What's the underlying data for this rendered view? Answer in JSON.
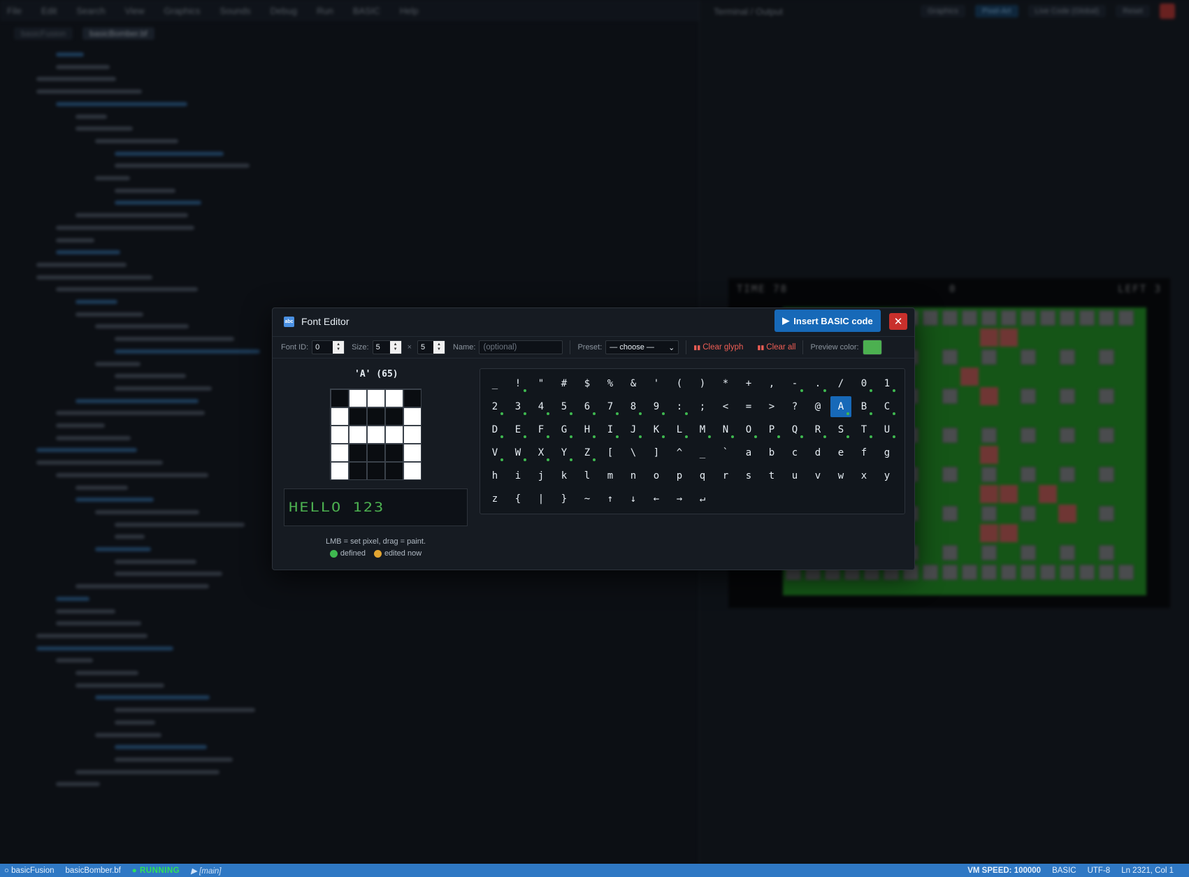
{
  "background": {
    "menu": [
      "File",
      "Edit",
      "Search",
      "View",
      "Graphics",
      "Sounds",
      "Debug",
      "Run",
      "BASIC",
      "Help"
    ],
    "tabs": [
      "basicFusion",
      "basicBomber.bf"
    ],
    "right_pane_title": "Terminal / Output",
    "right_buttons": [
      "Graphics",
      "Pixel-Art",
      "Live Code (Global)",
      "Reset"
    ],
    "hud": {
      "left": "TIME 78",
      "mid": "0",
      "right": "LEFT 3"
    }
  },
  "modal": {
    "title": "Font Editor",
    "insert_label": "Insert BASIC code",
    "close_symbol": "✕",
    "toolbar": {
      "font_id_label": "Font ID:",
      "font_id": "0",
      "size_label": "Size:",
      "size_w": "5",
      "size_x": "×",
      "size_h": "5",
      "name_label": "Name:",
      "name_placeholder": "(optional)",
      "preset_label": "Preset:",
      "preset_value": "— choose —",
      "clear_glyph": "Clear glyph",
      "clear_all": "Clear all",
      "preview_color_label": "Preview color:",
      "preview_color": "#4cb050"
    },
    "glyph": {
      "title": "'A' (65)",
      "pixels": [
        [
          0,
          1,
          1,
          1,
          0
        ],
        [
          1,
          0,
          0,
          0,
          1
        ],
        [
          1,
          1,
          1,
          1,
          1
        ],
        [
          1,
          0,
          0,
          0,
          1
        ],
        [
          1,
          0,
          0,
          0,
          1
        ]
      ]
    },
    "preview_text": "HELLO 123",
    "hint": "LMB = set pixel, drag = paint.",
    "legend": [
      {
        "label": "defined",
        "color": "#3fb950"
      },
      {
        "label": "edited now",
        "color": "#e3a531"
      }
    ],
    "chars": [
      {
        "c": "_",
        "d": false
      },
      {
        "c": "!",
        "d": true
      },
      {
        "c": "\"",
        "d": false
      },
      {
        "c": "#",
        "d": false
      },
      {
        "c": "$",
        "d": false
      },
      {
        "c": "%",
        "d": false
      },
      {
        "c": "&",
        "d": false
      },
      {
        "c": "'",
        "d": false
      },
      {
        "c": "(",
        "d": false
      },
      {
        "c": ")",
        "d": false
      },
      {
        "c": "*",
        "d": false
      },
      {
        "c": "+",
        "d": false
      },
      {
        "c": ",",
        "d": false
      },
      {
        "c": "-",
        "d": true
      },
      {
        "c": ".",
        "d": true
      },
      {
        "c": "/",
        "d": false
      },
      {
        "c": "0",
        "d": true
      },
      {
        "c": "1",
        "d": true
      },
      {
        "c": "2",
        "d": true
      },
      {
        "c": "3",
        "d": true
      },
      {
        "c": "4",
        "d": true
      },
      {
        "c": "5",
        "d": true
      },
      {
        "c": "6",
        "d": true
      },
      {
        "c": "7",
        "d": true
      },
      {
        "c": "8",
        "d": true
      },
      {
        "c": "9",
        "d": true
      },
      {
        "c": ":",
        "d": true
      },
      {
        "c": ";",
        "d": false
      },
      {
        "c": "<",
        "d": false
      },
      {
        "c": "=",
        "d": false
      },
      {
        "c": ">",
        "d": false
      },
      {
        "c": "?",
        "d": false
      },
      {
        "c": "@",
        "d": false
      },
      {
        "c": "A",
        "d": true,
        "sel": true
      },
      {
        "c": "B",
        "d": true
      },
      {
        "c": "C",
        "d": true
      },
      {
        "c": "D",
        "d": true
      },
      {
        "c": "E",
        "d": true
      },
      {
        "c": "F",
        "d": true
      },
      {
        "c": "G",
        "d": true
      },
      {
        "c": "H",
        "d": true
      },
      {
        "c": "I",
        "d": true
      },
      {
        "c": "J",
        "d": true
      },
      {
        "c": "K",
        "d": true
      },
      {
        "c": "L",
        "d": true
      },
      {
        "c": "M",
        "d": true
      },
      {
        "c": "N",
        "d": true
      },
      {
        "c": "O",
        "d": true
      },
      {
        "c": "P",
        "d": true
      },
      {
        "c": "Q",
        "d": true
      },
      {
        "c": "R",
        "d": true
      },
      {
        "c": "S",
        "d": true
      },
      {
        "c": "T",
        "d": true
      },
      {
        "c": "U",
        "d": true
      },
      {
        "c": "V",
        "d": true
      },
      {
        "c": "W",
        "d": true
      },
      {
        "c": "X",
        "d": true
      },
      {
        "c": "Y",
        "d": true
      },
      {
        "c": "Z",
        "d": true
      },
      {
        "c": "[",
        "d": false
      },
      {
        "c": "\\",
        "d": false
      },
      {
        "c": "]",
        "d": false
      },
      {
        "c": "^",
        "d": false
      },
      {
        "c": "_",
        "d": false
      },
      {
        "c": "`",
        "d": false
      },
      {
        "c": "a",
        "d": false
      },
      {
        "c": "b",
        "d": false
      },
      {
        "c": "c",
        "d": false
      },
      {
        "c": "d",
        "d": false
      },
      {
        "c": "e",
        "d": false
      },
      {
        "c": "f",
        "d": false
      },
      {
        "c": "g",
        "d": false
      },
      {
        "c": "h",
        "d": false
      },
      {
        "c": "i",
        "d": false
      },
      {
        "c": "j",
        "d": false
      },
      {
        "c": "k",
        "d": false
      },
      {
        "c": "l",
        "d": false
      },
      {
        "c": "m",
        "d": false
      },
      {
        "c": "n",
        "d": false
      },
      {
        "c": "o",
        "d": false
      },
      {
        "c": "p",
        "d": false
      },
      {
        "c": "q",
        "d": false
      },
      {
        "c": "r",
        "d": false
      },
      {
        "c": "s",
        "d": false
      },
      {
        "c": "t",
        "d": false
      },
      {
        "c": "u",
        "d": false
      },
      {
        "c": "v",
        "d": false
      },
      {
        "c": "w",
        "d": false
      },
      {
        "c": "x",
        "d": false
      },
      {
        "c": "y",
        "d": false
      },
      {
        "c": "z",
        "d": false
      },
      {
        "c": "{",
        "d": false
      },
      {
        "c": "|",
        "d": false
      },
      {
        "c": "}",
        "d": false
      },
      {
        "c": "~",
        "d": false
      },
      {
        "c": "↑",
        "d": false
      },
      {
        "c": "↓",
        "d": false
      },
      {
        "c": "←",
        "d": false
      },
      {
        "c": "→",
        "d": false
      },
      {
        "c": "↵",
        "d": false
      }
    ]
  },
  "statusbar": {
    "app": "basicFusion",
    "file": "basicBomber.bf",
    "state": "RUNNING",
    "branch": "▶ [main]",
    "vm_speed": "VM SPEED: 100000",
    "language": "BASIC",
    "encoding": "UTF-8",
    "position": "Ln 2321, Col 1"
  }
}
